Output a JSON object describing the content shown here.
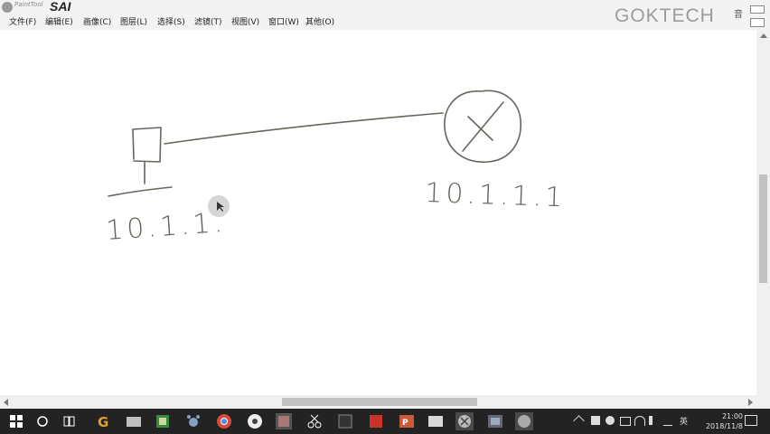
{
  "app": {
    "subtitle": "PaintTool",
    "name": "SAI"
  },
  "watermark": "GOKTECH",
  "window_button": "音",
  "menu": {
    "items": [
      {
        "label": "文件(F)"
      },
      {
        "label": "编辑(E)"
      },
      {
        "label": "画像(C)"
      },
      {
        "label": "图层(L)"
      },
      {
        "label": "选择(S)"
      },
      {
        "label": "滤镜(T)"
      },
      {
        "label": "视图(V)"
      },
      {
        "label": "窗口(W)"
      },
      {
        "label": "其他(O)"
      }
    ]
  },
  "canvas": {
    "left_address": "10.1.1.",
    "right_address": "10.1.1.1"
  },
  "taskbar": {
    "language": "英",
    "time": "21:00",
    "date": "2018/11/8",
    "icons": [
      "windows-start-icon",
      "search-circle-icon",
      "task-view-icon",
      "app-g-icon",
      "app-folder-icon",
      "app-green-icon",
      "app-paw-icon",
      "app-chrome-icon",
      "app-disc-icon",
      "app-image-icon",
      "app-scissors-icon",
      "app-dark-icon",
      "app-red-icon",
      "app-powerpoint-icon",
      "app-window-icon",
      "app-network-icon",
      "app-screenshot-icon",
      "app-sai-icon"
    ]
  },
  "colors": {
    "ink": "#6b645c",
    "taskbar": "#232323",
    "canvas": "#ffffff"
  }
}
